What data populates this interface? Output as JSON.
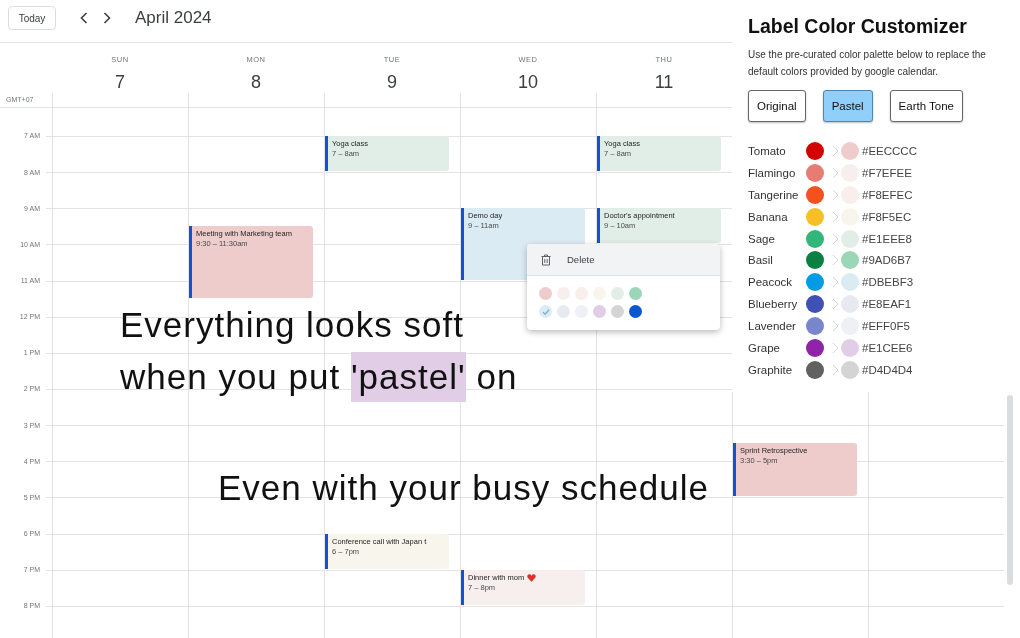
{
  "toolbar": {
    "today_button": "Today",
    "title": "April 2024"
  },
  "timezone": "GMT+07",
  "days": [
    {
      "weekday": "SUN",
      "date": "7"
    },
    {
      "weekday": "MON",
      "date": "8",
      "events": [
        {
          "kind": "plain",
          "title": "Meeting with Marketing team",
          "time": "9:30 – 11:30am",
          "color": "#eecccc"
        }
      ]
    },
    {
      "weekday": "TUE",
      "date": "9",
      "events": [
        {
          "kind": "plain",
          "title": "Yoga class",
          "time": "7 – 8am",
          "color": "#e1eee8"
        },
        {
          "kind": "plain",
          "title": "Conference call with Japan t",
          "time": "6 – 7pm",
          "color": "#f8f5ec"
        }
      ]
    },
    {
      "weekday": "WED",
      "date": "10",
      "events": [
        {
          "kind": "plain",
          "title": "Demo day",
          "time": "9 – 11am",
          "color": "#dbebf3"
        },
        {
          "kind": "decorated",
          "title": "Dinner with mom",
          "time": "7 – 8pm",
          "color": "#f7efee"
        }
      ]
    },
    {
      "weekday": "THU",
      "date": "11",
      "events": [
        {
          "kind": "plain",
          "title": "Yoga class",
          "time": "7 – 8am",
          "color": "#e1eee8"
        },
        {
          "kind": "plain",
          "title": "Doctor's appointment",
          "time": "9 – 10am",
          "color": "#e1eee8"
        }
      ]
    },
    {
      "events": [
        {
          "kind": "plain",
          "title": "Sprint Retrospective",
          "time": "3:30 – 5pm",
          "color": "#eecccc"
        }
      ]
    }
  ],
  "hours": [
    "7 AM",
    "8 AM",
    "9 AM",
    "10 AM",
    "11 AM",
    "12 PM",
    "1 PM",
    "2 PM",
    "3 PM",
    "4 PM",
    "5 PM",
    "6 PM",
    "7 PM",
    "8 PM"
  ],
  "event_menu": {
    "delete_label": "Delete",
    "colors": [
      {
        "color": "#eecccc",
        "selected": false
      },
      {
        "color": "#f7efee",
        "selected": false
      },
      {
        "color": "#f8efec",
        "selected": false
      },
      {
        "color": "#f8f5ec",
        "selected": false
      },
      {
        "color": "#e1eee8",
        "selected": false
      },
      {
        "color": "#9ad6b7",
        "selected": false
      },
      {
        "color": "#dbebf3",
        "selected": true
      },
      {
        "color": "#e8eaf1",
        "selected": false
      },
      {
        "color": "#eff0f5",
        "selected": false
      },
      {
        "color": "#e1cee6",
        "selected": false
      },
      {
        "color": "#d4d4d4",
        "selected": false
      },
      {
        "color": "#0b57d0",
        "selected": false
      }
    ]
  },
  "captions": [
    {
      "parts": [
        {
          "text": "Everything looks soft",
          "highlighted": false
        }
      ]
    },
    {
      "parts": [
        {
          "text": "when you put ",
          "highlighted": false
        },
        {
          "text": "'pastel'",
          "highlighted": true
        },
        {
          "text": " on",
          "highlighted": false
        }
      ]
    },
    {
      "parts": [
        {
          "text": "Even with your busy schedule",
          "highlighted": false
        }
      ]
    }
  ],
  "panel": {
    "title": "Label Color Customizer",
    "description": "Use the pre-curated color palette below to replace the default colors provided by google calendar.",
    "palettes": [
      {
        "label": "Original",
        "selected": false
      },
      {
        "label": "Pastel",
        "selected": true
      },
      {
        "label": "Earth Tone",
        "selected": false
      }
    ],
    "colors": [
      {
        "name": "Tomato",
        "color": "#d50000",
        "hex": "#EECCCC"
      },
      {
        "name": "Flamingo",
        "color": "#e67c73",
        "hex": "#F7EFEE"
      },
      {
        "name": "Tangerine",
        "color": "#f4511e",
        "hex": "#F8EFEC"
      },
      {
        "name": "Banana",
        "color": "#f6bf26",
        "hex": "#F8F5EC"
      },
      {
        "name": "Sage",
        "color": "#33b679",
        "hex": "#E1EEE8"
      },
      {
        "name": "Basil",
        "color": "#0b8043",
        "hex": "#9AD6B7"
      },
      {
        "name": "Peacock",
        "color": "#039be5",
        "hex": "#DBEBF3"
      },
      {
        "name": "Blueberry",
        "color": "#3f51b5",
        "hex": "#E8EAF1"
      },
      {
        "name": "Lavender",
        "color": "#7986cb",
        "hex": "#EFF0F5"
      },
      {
        "name": "Grape",
        "color": "#8e24aa",
        "hex": "#E1CEE6"
      },
      {
        "name": "Graphite",
        "color": "#616161",
        "hex": "#D4D4D4"
      }
    ]
  }
}
